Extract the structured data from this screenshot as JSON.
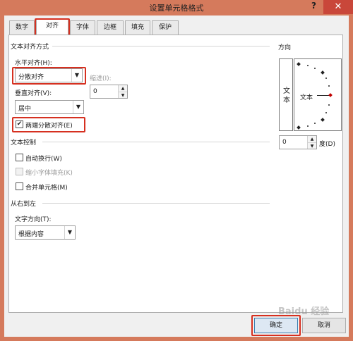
{
  "window": {
    "title": "设置单元格格式",
    "help": "?",
    "close": "✕"
  },
  "tabs": [
    {
      "label": "数字"
    },
    {
      "label": "对齐"
    },
    {
      "label": "字体"
    },
    {
      "label": "边框"
    },
    {
      "label": "填充"
    },
    {
      "label": "保护"
    }
  ],
  "text_alignment": {
    "section_title": "文本对齐方式",
    "horizontal_label": "水平对齐(H):",
    "horizontal_value": "分散对齐",
    "indent_label": "缩进(I):",
    "indent_value": "0",
    "vertical_label": "垂直对齐(V):",
    "vertical_value": "居中",
    "justify_distributed_label": "两端分散对齐(E)"
  },
  "text_control": {
    "section_title": "文本控制",
    "wrap_text_label": "自动换行(W)",
    "shrink_to_fit_label": "缩小字体填充(K)",
    "merge_cells_label": "合并单元格(M)"
  },
  "rtl": {
    "section_title": "从右到左",
    "direction_label": "文字方向(T):",
    "direction_value": "根据内容"
  },
  "orientation": {
    "section_title": "方向",
    "vertical_text": "文本",
    "dial_text": "文本",
    "degrees_value": "0",
    "degrees_label": "度(D)"
  },
  "buttons": {
    "ok": "确定",
    "cancel": "取消"
  },
  "checkbox_marks": {
    "checked": "✔"
  },
  "watermark": "Baidu 经验",
  "colors": {
    "title_bar": "#d57a5c",
    "highlight": "#d63020"
  }
}
